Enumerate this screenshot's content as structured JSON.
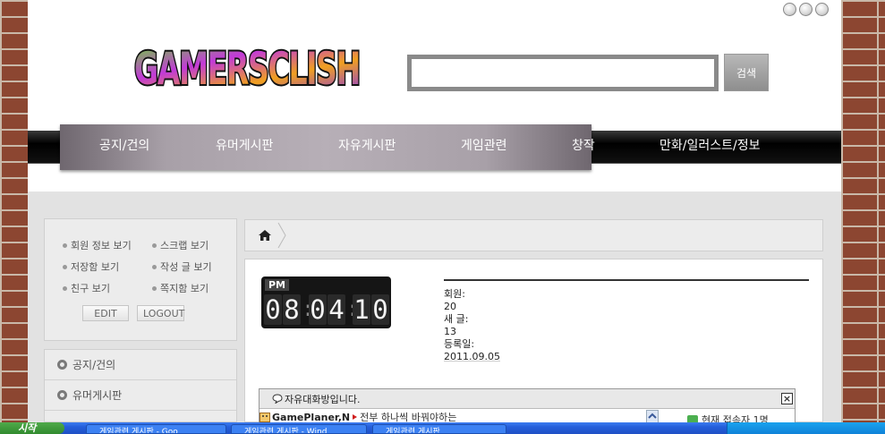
{
  "logo_text": "GAMERSCLISH",
  "search": {
    "placeholder": "",
    "button_label": "검색"
  },
  "nav": {
    "items": [
      {
        "label": "공지/건의"
      },
      {
        "label": "유머게시판"
      },
      {
        "label": "자유게시판"
      },
      {
        "label": "게임관련"
      },
      {
        "label": "창작"
      },
      {
        "label": "만화/일러스트/정보"
      }
    ]
  },
  "user_links": [
    "회원 정보 보기",
    "스크랩 보기",
    "저장함 보기",
    "작성 글 보기",
    "친구 보기",
    "쪽지함 보기"
  ],
  "user_buttons": {
    "edit": "EDIT",
    "logout": "LOGOUT"
  },
  "side_menu": [
    {
      "label": "공지/건의"
    },
    {
      "label": "유머게시판"
    }
  ],
  "clock": {
    "ampm": "PM",
    "h1": "0",
    "h2": "8",
    "m1": "0",
    "m2": "4",
    "s1": "1",
    "s2": "0"
  },
  "stats": {
    "members_label": "회원:",
    "members_value": "20",
    "new_posts_label": "새 글:",
    "new_posts_value": "13",
    "registered_label": "등록일:",
    "registered_value": "2011.09.05"
  },
  "chat": {
    "title": "자유대화방입니다.",
    "close": "×",
    "name": "GamePlaner,N",
    "message": "전부 하나씩 바꿔야하는",
    "online": "현재 접속자 1명"
  },
  "taskbar": {
    "start": "시작",
    "tasks": [
      "게임관련 게시판 - Goo",
      "게임관련 게시판 - Wind",
      "게임관련 게시판"
    ]
  },
  "colors": {
    "nav_bar": "#000000",
    "nav_panel": "#a8a0a8",
    "search_border": "#8a8a8a"
  }
}
